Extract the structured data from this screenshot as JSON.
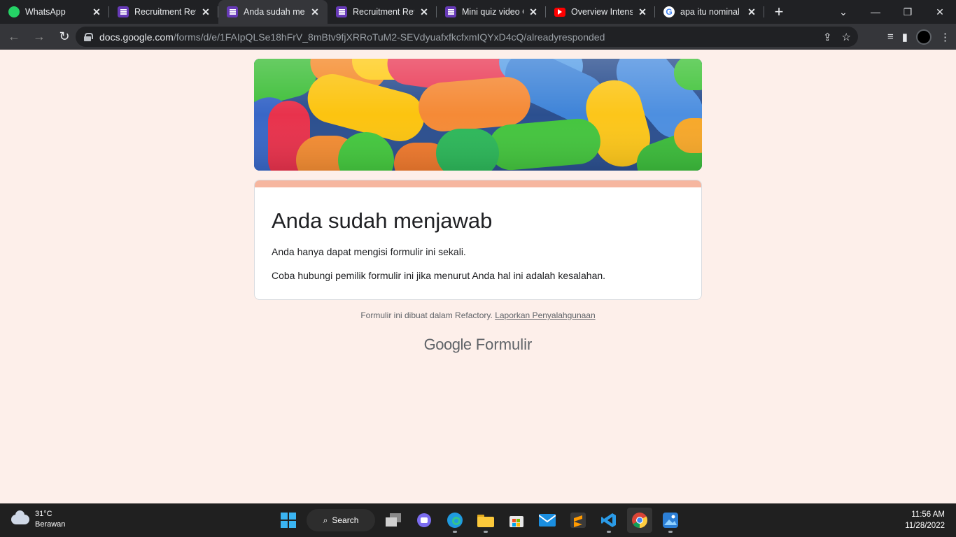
{
  "browser": {
    "tabs": [
      {
        "title": "WhatsApp",
        "icon": "whatsapp-icon",
        "active": false
      },
      {
        "title": "Recruitment Refa",
        "icon": "google-forms-icon",
        "active": false
      },
      {
        "title": "Anda sudah menj",
        "icon": "google-forms-icon",
        "active": true
      },
      {
        "title": "Recruitment Refa",
        "icon": "google-forms-icon",
        "active": false
      },
      {
        "title": "Mini quiz video C",
        "icon": "google-forms-icon",
        "active": false
      },
      {
        "title": "Overview Intensiv",
        "icon": "youtube-icon",
        "active": false
      },
      {
        "title": "apa itu nominal s",
        "icon": "google-icon",
        "active": false
      }
    ],
    "url_host": "docs.google.com",
    "url_path": "/forms/d/e/1FAIpQLSe18hFrV_8mBtv9fjXRRoTuM2-SEVdyuafxfkcfxmIQYxD4cQ/alreadyresponded"
  },
  "form": {
    "title": "Anda sudah menjawab",
    "line1": "Anda hanya dapat mengisi formulir ini sekali.",
    "line2": "Coba hubungi pemilik formulir ini jika menurut Anda hal ini adalah kesalahan.",
    "footer_text": "Formulir ini dibuat dalam Refactory.",
    "report_link": "Laporkan Penyalahgunaan",
    "brand_google": "Google",
    "brand_product": "Formulir",
    "accent_color": "#f6b69f",
    "background_color": "#fdefea"
  },
  "taskbar": {
    "weather_temp": "31°C",
    "weather_desc": "Berawan",
    "search_label": "Search",
    "time": "11:56 AM",
    "date": "11/28/2022"
  }
}
